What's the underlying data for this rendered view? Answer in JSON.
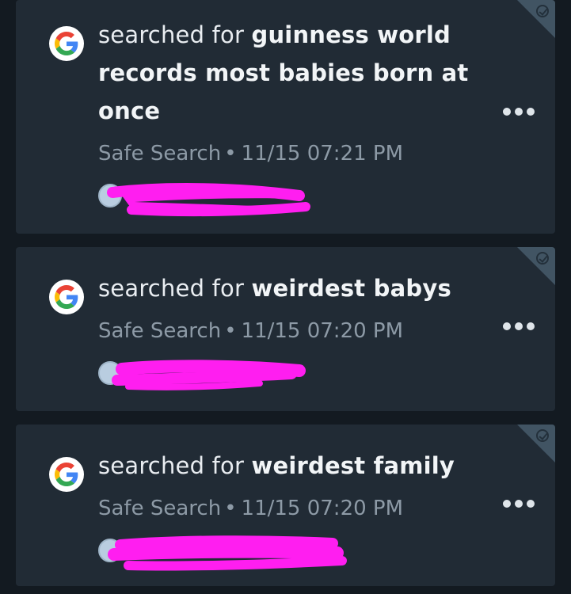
{
  "feed": {
    "items": [
      {
        "prefix": "searched for ",
        "query": "guinness world records most babies born at once",
        "source": "Safe Search",
        "separator": "•",
        "timestamp": "11/15 07:21 PM"
      },
      {
        "prefix": "searched for ",
        "query": "weirdest babys",
        "source": "Safe Search",
        "separator": "•",
        "timestamp": "11/15 07:20 PM"
      },
      {
        "prefix": "searched for ",
        "query": "weirdest family",
        "source": "Safe Search",
        "separator": "•",
        "timestamp": "11/15 07:20 PM"
      }
    ]
  },
  "icons": {
    "app": "google-g-icon",
    "reviewed": "check-circle-icon",
    "menu": "more-horizontal-icon",
    "user": "user-avatar-icon"
  },
  "colors": {
    "background": "#131a21",
    "card": "#212b35",
    "corner": "#415463",
    "text": "#e9edf1",
    "meta": "#8d9aa6",
    "redaction": "#ff1ef0"
  }
}
